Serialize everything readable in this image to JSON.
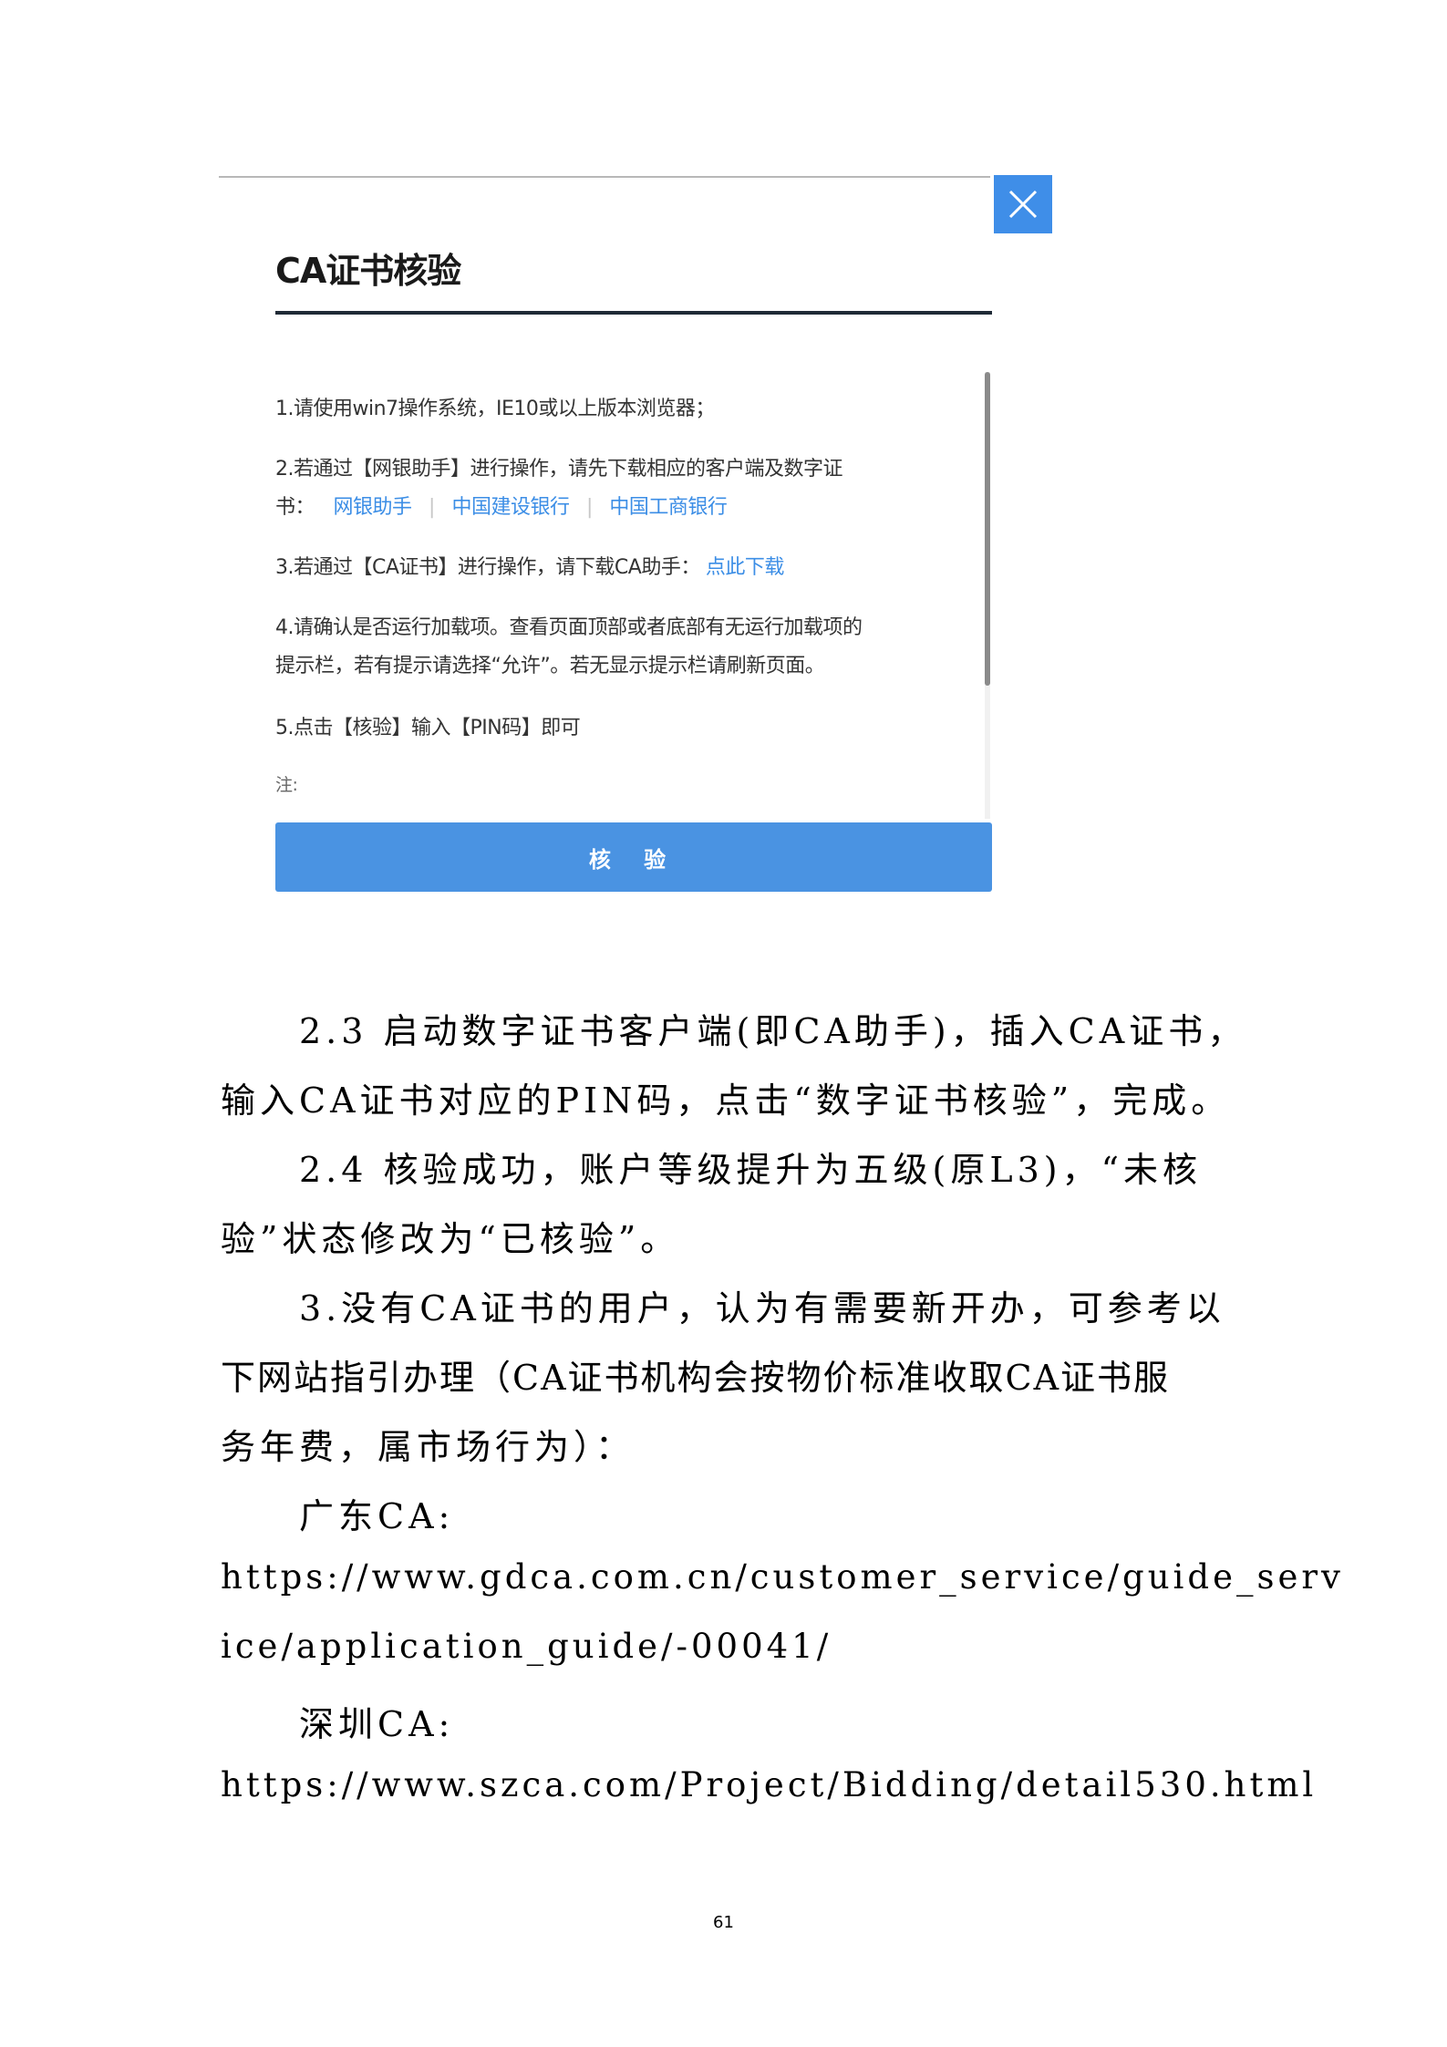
{
  "dialog": {
    "title": "CA证书核验",
    "close_icon": "close-icon",
    "steps": {
      "s1": "1.请使用win7操作系统，IE10或以上版本浏览器；",
      "s2_line1": "2.若通过【网银助手】进行操作，请先下载相应的客户端及数字证",
      "s2_prefix": "书：",
      "s2_links": [
        "网银助手",
        "中国建设银行",
        "中国工商银行"
      ],
      "s3": "3.若通过【CA证书】进行操作，请下载CA助手：",
      "s3_link": "点此下载",
      "s4_line1": "4.请确认是否运行加载项。查看页面顶部或者底部有无运行加载项的",
      "s4_line2": "提示栏，若有提示请选择“允许”。若无显示提示栏请刷新页面。",
      "s5": "5.点击【核验】输入【PIN码】即可",
      "note": "注:"
    },
    "button_label": "核 验",
    "colors": {
      "accent": "#3f8ee8",
      "button": "#4a93e2",
      "link": "#3c8ee6",
      "title_rule": "#1f2a36"
    }
  },
  "document": {
    "p1_line1": "2.3 启动数字证书客户端(即CA助手)，插入CA证书，",
    "p1_line2": "输入CA证书对应的PIN码，点击“数字证书核验”，完成。",
    "p2_line1": "2.4 核验成功，账户等级提升为五级(原L3)，“未核",
    "p2_line2": "验”状态修改为“已核验”。",
    "p3_line1": "3.没有CA证书的用户，认为有需要新开办，可参考以",
    "p3_line2": "下网站指引办理（CA证书机构会按物价标准收取CA证书服",
    "p3_line3": "务年费，属市场行为）：",
    "gd_label": "广东CA:",
    "gd_url_line1": "https://www.gdca.com.cn/customer_service/guide_serv",
    "gd_url_line2": "ice/application_guide/-00041/",
    "sz_label": "深圳CA:",
    "sz_url": "https://www.szca.com/Project/Bidding/detail530.html"
  },
  "page_number": "61"
}
